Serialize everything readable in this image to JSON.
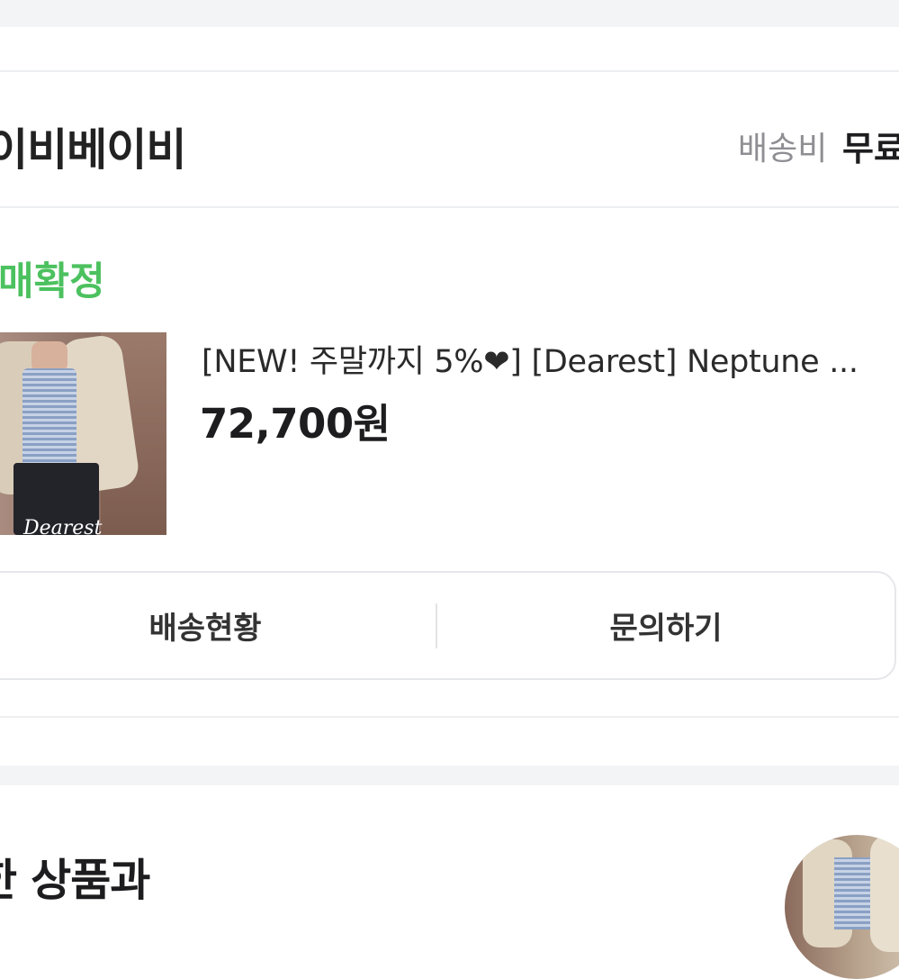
{
  "shop": {
    "name": "이비베이비",
    "shipping_label": "배송비",
    "shipping_value": "무료"
  },
  "order": {
    "status": "매확정",
    "status_color": "#4cc15f",
    "product_title": "[NEW! 주말까지 5%❤] [Dearest] Neptune ...",
    "price": "72,700원",
    "thumbnail_watermark": "Dearest"
  },
  "actions": {
    "delivery_status": "배송현황",
    "inquiry": "문의하기"
  },
  "recommend": {
    "title": "한 상품과"
  }
}
